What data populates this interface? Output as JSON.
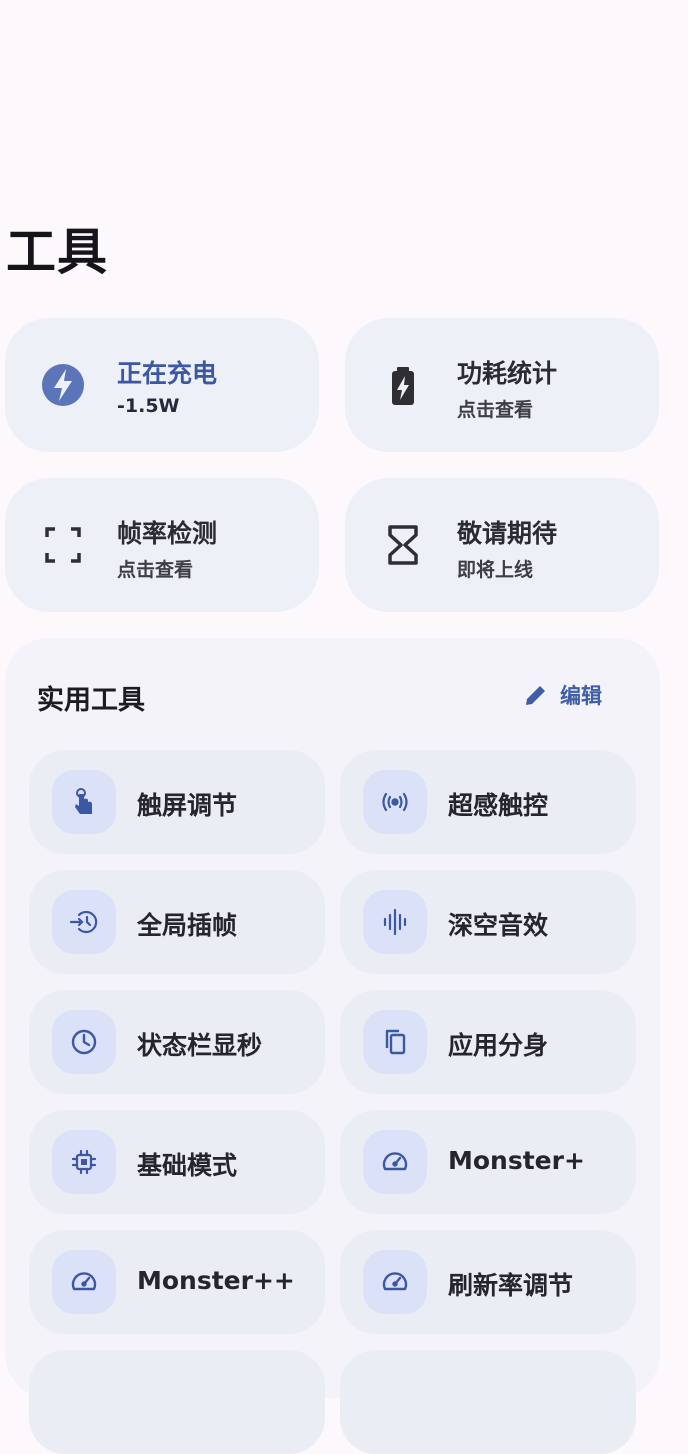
{
  "page": {
    "title": "工具"
  },
  "cards": [
    {
      "title": "正在充电",
      "subtitle": "-1.5W",
      "icon": "lightning-icon"
    },
    {
      "title": "功耗统计",
      "subtitle": "点击查看",
      "icon": "battery-icon"
    },
    {
      "title": "帧率检测",
      "subtitle": "点击查看",
      "icon": "frame-icon"
    },
    {
      "title": "敬请期待",
      "subtitle": "即将上线",
      "icon": "hourglass-icon"
    }
  ],
  "tools_section": {
    "title": "实用工具",
    "edit_label": "编辑",
    "items": [
      {
        "label": "触屏调节",
        "icon": "touch-icon"
      },
      {
        "label": "超感触控",
        "icon": "vibration-icon"
      },
      {
        "label": "全局插帧",
        "icon": "frame-insert-icon"
      },
      {
        "label": "深空音效",
        "icon": "sound-wave-icon"
      },
      {
        "label": "状态栏显秒",
        "icon": "clock-icon"
      },
      {
        "label": "应用分身",
        "icon": "copy-icon"
      },
      {
        "label": "基础模式",
        "icon": "chip-icon"
      },
      {
        "label": "Monster+",
        "icon": "speedometer-icon"
      },
      {
        "label": "Monster++",
        "icon": "speedometer-icon"
      },
      {
        "label": "刷新率调节",
        "icon": "speedometer-icon"
      }
    ]
  },
  "colors": {
    "accent": "#3d58a3",
    "card_bg": "#eef0f7",
    "icon_bg": "#dbe2f7"
  }
}
